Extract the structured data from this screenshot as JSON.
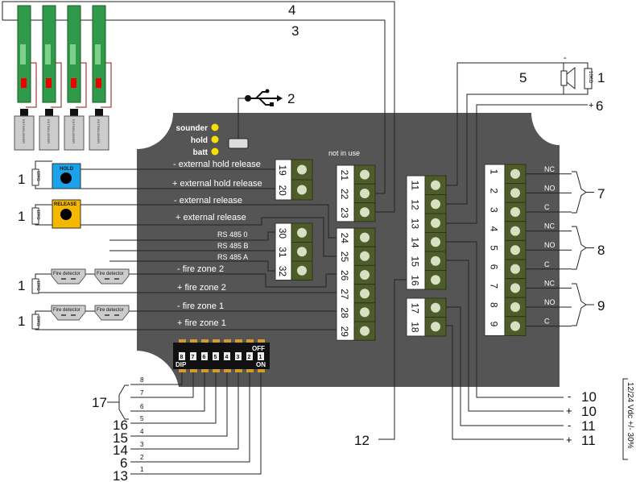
{
  "callouts": {
    "c1": "1",
    "c2": "2",
    "c3": "3",
    "c4": "4",
    "c5": "5",
    "c6": "6",
    "c7": "7",
    "c8": "8",
    "c9": "9",
    "c10a": "10",
    "c10b": "10",
    "c11a": "11",
    "c11b": "11",
    "c12": "12",
    "c13": "13",
    "c14": "14",
    "c15": "15",
    "c16": "16",
    "c17": "17",
    "c6b": "6"
  },
  "polarity": {
    "minus": "-",
    "plus": "+"
  },
  "leds": [
    {
      "label": "sounder"
    },
    {
      "label": "hold"
    },
    {
      "label": "batt"
    }
  ],
  "led_color": "#f5e000",
  "board_labels": {
    "not_in_use": "not in use",
    "ext_hold_minus": "- external hold release",
    "ext_hold_plus": "+ external hold release",
    "ext_rel_minus": "- external release",
    "ext_rel_plus": "+ external release",
    "rs485_0": "RS 485 0",
    "rs485_b": "RS 485 B",
    "rs485_a": "RS 485 A",
    "fz2_minus": "-  fire zone 2",
    "fz2_plus": "+ fire zone 2",
    "fz1_minus": "-  fire zone 1",
    "fz1_plus": "+ fire zone 1"
  },
  "relay_labels": [
    "NC",
    "NO",
    "C",
    "NC",
    "NO",
    "C",
    "NC",
    "NO",
    "C"
  ],
  "terminal_blocks": [
    {
      "id": "19-20",
      "numbers": [
        "19",
        "20"
      ]
    },
    {
      "id": "21-23",
      "numbers": [
        "21",
        "22",
        "23"
      ]
    },
    {
      "id": "24-29",
      "numbers": [
        "24",
        "25",
        "26",
        "27",
        "28",
        "29"
      ]
    },
    {
      "id": "30-32",
      "numbers": [
        "30",
        "31",
        "32"
      ]
    },
    {
      "id": "11-16",
      "numbers": [
        "11",
        "12",
        "13",
        "14",
        "15",
        "16"
      ]
    },
    {
      "id": "17-18",
      "numbers": [
        "17",
        "18"
      ]
    },
    {
      "id": "1-9",
      "numbers": [
        "1",
        "2",
        "3",
        "4",
        "5",
        "6",
        "7",
        "8",
        "9"
      ]
    }
  ],
  "dip": {
    "label": "DIP",
    "off": "OFF",
    "on": "ON",
    "switches": [
      "8",
      "7",
      "6",
      "5",
      "4",
      "3",
      "2",
      "1"
    ],
    "pin_labels": [
      "8",
      "7",
      "6",
      "5",
      "4",
      "3",
      "2",
      "1"
    ]
  },
  "buttons": {
    "hold": "HOLD",
    "release": "RELEASE"
  },
  "button_colors": {
    "hold": "#1aa3e8",
    "release": "#f5b800"
  },
  "detector_label": "Fire detector",
  "extinguisher_label": "EXTINGUISHER",
  "resistor_label": "10KΩ",
  "power_note": "12/24 Vdc +/- 30%",
  "colors": {
    "board": "#555555",
    "terminal": "#4e5b2a",
    "pin": "#d8dfc2"
  }
}
